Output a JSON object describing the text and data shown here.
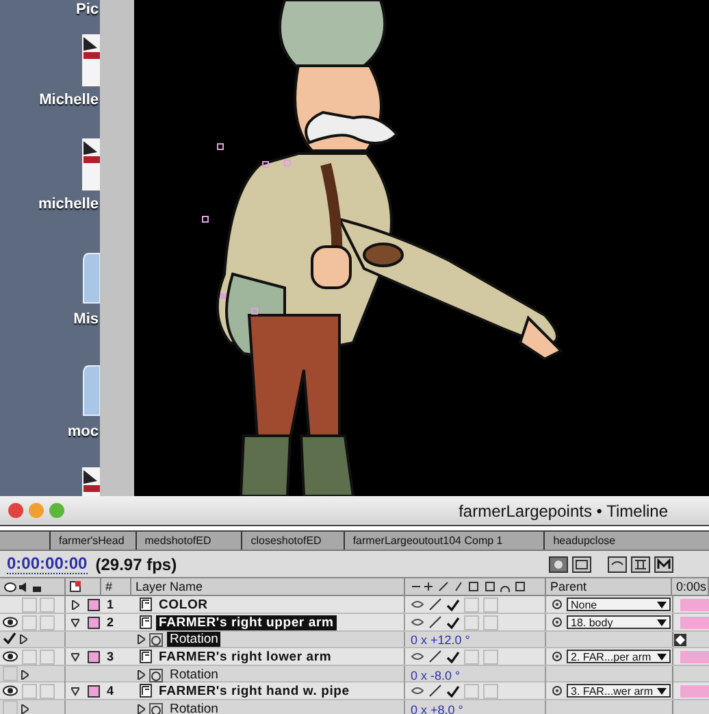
{
  "desktop_icons": [
    {
      "label": "Pic",
      "kind": "top"
    },
    {
      "label": "Michelle",
      "kind": "document"
    },
    {
      "label": "michelle",
      "kind": "document"
    },
    {
      "label": "Mis",
      "kind": "folder"
    },
    {
      "label": "moc",
      "kind": "folder"
    },
    {
      "kind": "document"
    }
  ],
  "window": {
    "title": "farmerLargepoints • Timeline"
  },
  "tabs": [
    {
      "label": "farmer'sHead",
      "selected": false
    },
    {
      "label": "medshotofED",
      "selected": false
    },
    {
      "label": "closeshotofED",
      "selected": false
    },
    {
      "label": "farmerLargeoutout104 Comp 1",
      "selected": false
    },
    {
      "label": "headupclose",
      "selected": false
    }
  ],
  "timecode": "0:00:00:00",
  "fps": "(29.97 fps)",
  "columns": {
    "number": "#",
    "layer_name": "Layer Name",
    "parent": "Parent",
    "time": "0:00s"
  },
  "layers": [
    {
      "number": "1",
      "solo": false,
      "lock": false,
      "motion_blur": false,
      "adjustment": false,
      "name": "COLOR",
      "visible": false,
      "expanded": false,
      "selected": false,
      "parent": "None"
    },
    {
      "number": "2",
      "solo": false,
      "lock": false,
      "motion_blur": false,
      "adjustment": false,
      "name": "FARMER's right upper arm",
      "visible": true,
      "expanded": true,
      "selected": true,
      "parent": "18. body",
      "property": {
        "name": "Rotation",
        "value": "0 x +12.0 °",
        "selected": true,
        "checked": true,
        "keyframe": true
      }
    },
    {
      "number": "3",
      "solo": false,
      "lock": false,
      "motion_blur": false,
      "adjustment": false,
      "name": "FARMER's right lower arm",
      "visible": true,
      "expanded": true,
      "selected": false,
      "parent": "2. FAR...per arm",
      "property": {
        "name": "Rotation",
        "value": "0 x -8.0 °",
        "selected": false,
        "checked": false,
        "keyframe": false
      }
    },
    {
      "number": "4",
      "solo": false,
      "lock": false,
      "motion_blur": false,
      "adjustment": false,
      "name": "FARMER's right hand w. pipe",
      "visible": true,
      "expanded": true,
      "selected": false,
      "parent": "3. FAR...wer arm",
      "property": {
        "name": "Rotation",
        "value": "0 x +8.0 °",
        "selected": false,
        "checked": false,
        "keyframe": false
      }
    }
  ]
}
